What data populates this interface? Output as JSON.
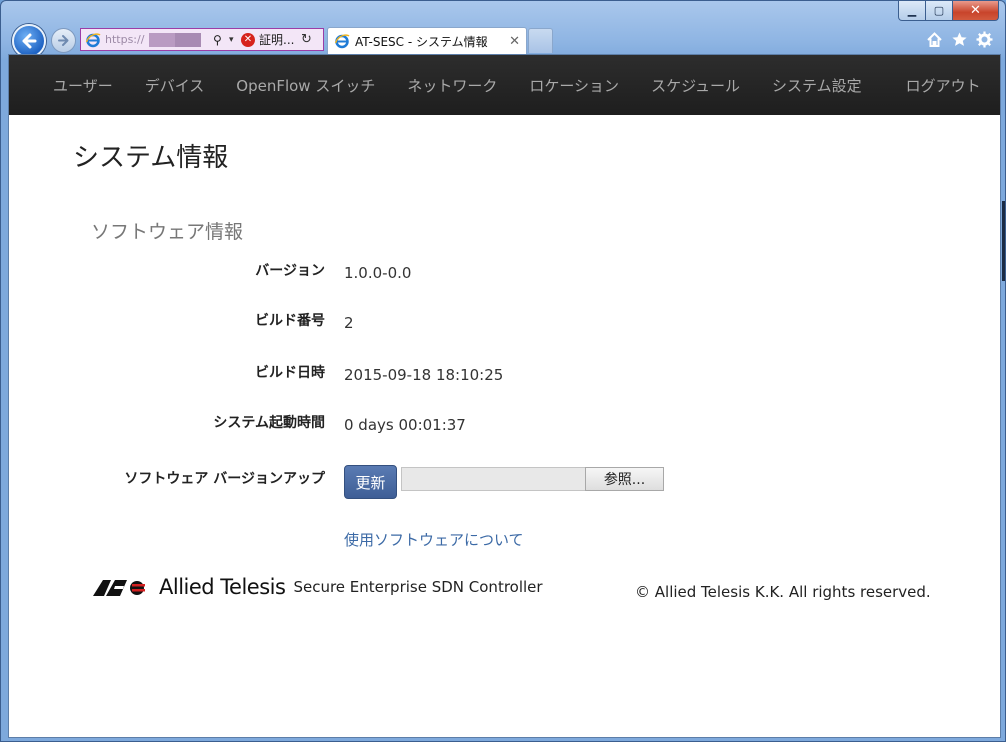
{
  "browser": {
    "tab_title": "AT-SESC - システム情報",
    "cert_text": "証明...",
    "address_text": "https://"
  },
  "nav": {
    "items": [
      "ユーザー",
      "デバイス",
      "OpenFlow スイッチ",
      "ネットワーク",
      "ロケーション",
      "スケジュール",
      "システム設定",
      "ログアウト"
    ]
  },
  "page": {
    "title": "システム情報",
    "section_title": "ソフトウェア情報",
    "rows": [
      {
        "label": "バージョン",
        "value": "1.0.0-0.0"
      },
      {
        "label": "ビルド番号",
        "value": "2"
      },
      {
        "label": "ビルド日時",
        "value": "2015-09-18 18:10:25"
      },
      {
        "label": "システム起動時間",
        "value": "0 days 00:01:37"
      }
    ],
    "upgrade_label": "ソフトウェア バージョンアップ",
    "update_button": "更新",
    "browse_button": "参照...",
    "software_link": "使用ソフトウェアについて"
  },
  "footer": {
    "brand": "Allied Telesis",
    "product": "Secure Enterprise SDN Controller",
    "copyright": "© Allied Telesis K.K. All rights reserved."
  },
  "colors": {
    "nav_bg": "#262626",
    "nav_text": "#a9a9a9",
    "button_blue": "#4a6aa3",
    "link": "#3c6aa6"
  }
}
